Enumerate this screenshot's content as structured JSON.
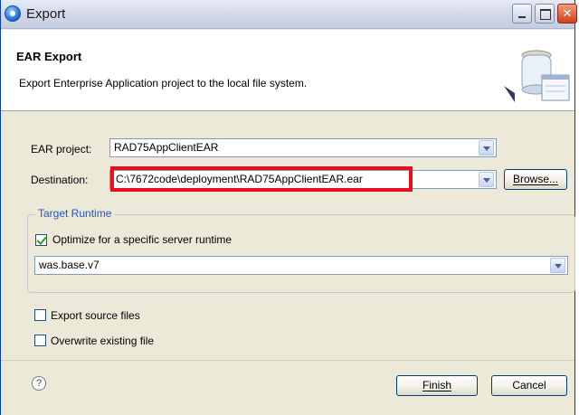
{
  "window": {
    "title": "Export",
    "icon": "eclipse-icon",
    "controls": [
      "minimize-icon",
      "maximize-icon",
      "close-icon"
    ]
  },
  "banner": {
    "title": "EAR Export",
    "description": "Export Enterprise Application project to the local file system."
  },
  "form": {
    "ear_project": {
      "label": "EAR project:",
      "value": "RAD75AppClientEAR"
    },
    "destination": {
      "label": "Destination:",
      "value": "C:\\7672code\\deployment\\RAD75AppClientEAR.ear",
      "browse_label": "Browse..."
    },
    "target_runtime": {
      "legend": "Target Runtime",
      "optimize_label": "Optimize for a specific server runtime",
      "optimize_checked": true,
      "runtime_value": "was.base.v7"
    },
    "export_source": {
      "label": "Export source files",
      "checked": false
    },
    "overwrite": {
      "label": "Overwrite existing file",
      "checked": false
    }
  },
  "footer": {
    "help_glyph": "?",
    "finish_label": "Finish",
    "cancel_label": "Cancel"
  },
  "colors": {
    "highlight": "#e8101e",
    "legend": "#2255c8",
    "dialog_bg": "#ece9d8"
  }
}
